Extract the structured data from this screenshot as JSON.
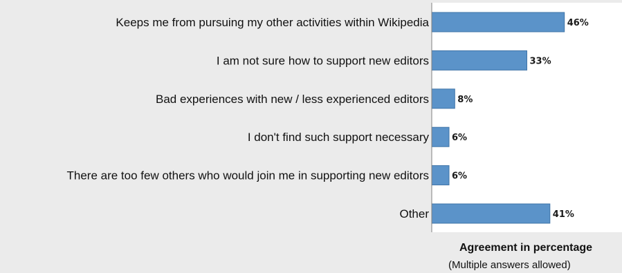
{
  "chart_data": {
    "type": "bar",
    "orientation": "horizontal",
    "categories": [
      "Keeps me from pursuing my other activities within Wikipedia",
      "I am not sure how to support new editors",
      "Bad experiences with new / less experienced editors",
      "I don't find such support necessary",
      "There are too few others who would join me in supporting new editors",
      "Other"
    ],
    "values": [
      46,
      33,
      8,
      6,
      6,
      41
    ],
    "value_labels": [
      "46%",
      "33%",
      "8%",
      "6%",
      "6%",
      "41%"
    ],
    "xlabel": "Agreement in percentage",
    "xlabel_note": "(Multiple answers allowed)",
    "xlim": [
      0,
      66
    ],
    "grid": false,
    "legend": "none",
    "colors": {
      "bar": "#5b93c9",
      "bar_border": "#3f74a8",
      "background": "#ebebeb",
      "plot_background": "#ffffff"
    }
  }
}
